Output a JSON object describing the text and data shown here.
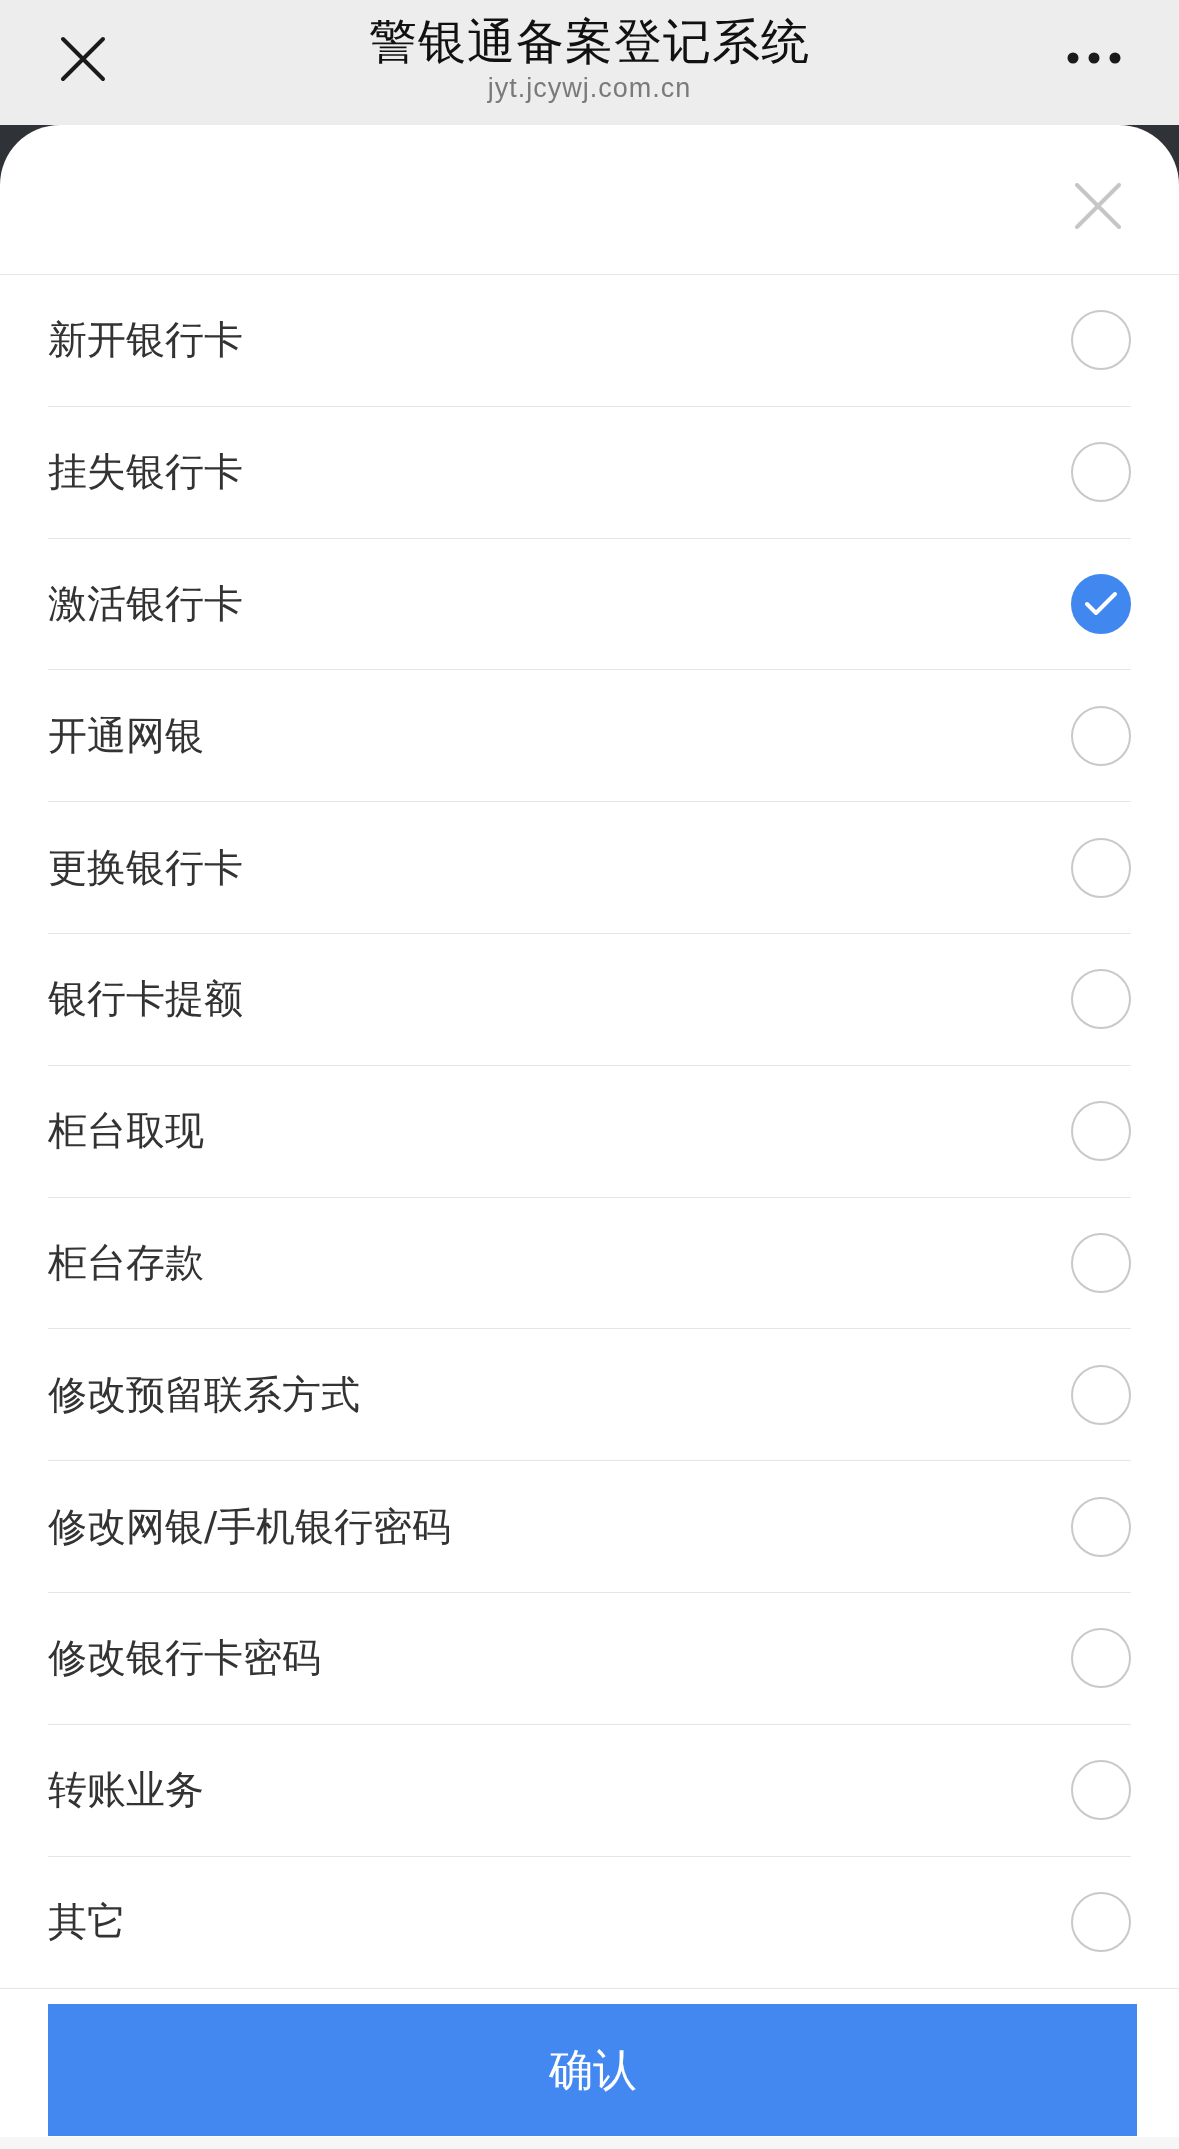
{
  "top_bar": {
    "title": "警银通备案登记系统",
    "url": "jyt.jcywj.com.cn"
  },
  "sheet": {
    "options": [
      {
        "label": "新开银行卡",
        "selected": false
      },
      {
        "label": "挂失银行卡",
        "selected": false
      },
      {
        "label": "激活银行卡",
        "selected": true
      },
      {
        "label": "开通网银",
        "selected": false
      },
      {
        "label": "更换银行卡",
        "selected": false
      },
      {
        "label": "银行卡提额",
        "selected": false
      },
      {
        "label": "柜台取现",
        "selected": false
      },
      {
        "label": "柜台存款",
        "selected": false
      },
      {
        "label": "修改预留联系方式",
        "selected": false
      },
      {
        "label": "修改网银/手机银行密码",
        "selected": false
      },
      {
        "label": "修改银行卡密码",
        "selected": false
      },
      {
        "label": "转账业务",
        "selected": false
      },
      {
        "label": "其它",
        "selected": false
      }
    ]
  },
  "footer": {
    "confirm_button": "确认"
  }
}
